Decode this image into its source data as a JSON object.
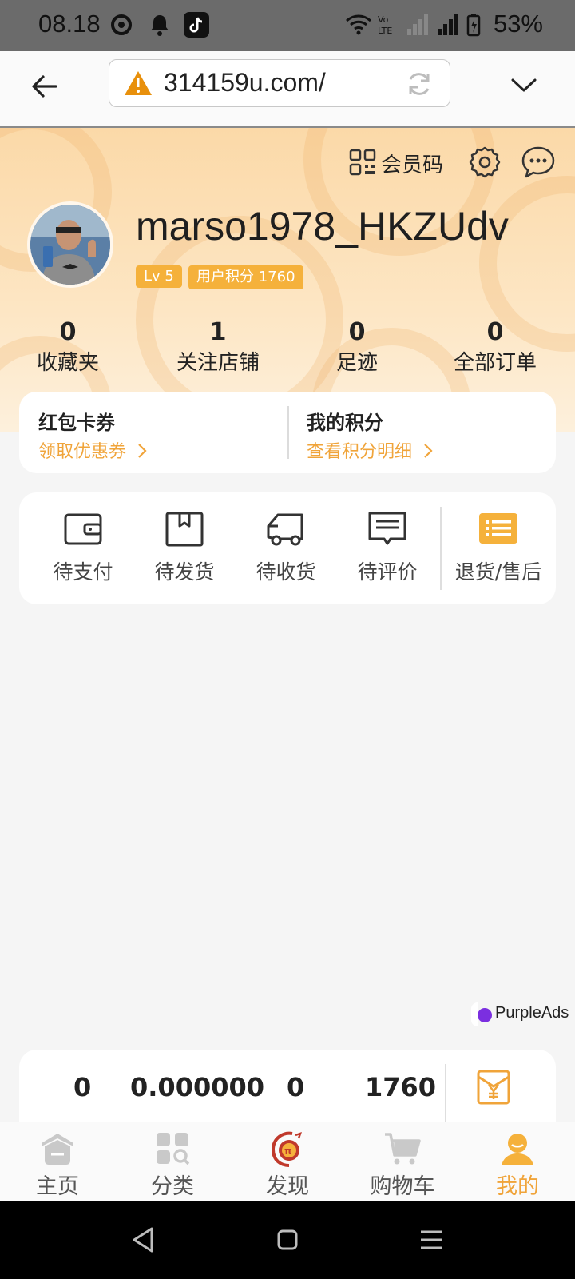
{
  "status_bar": {
    "time": "08.18",
    "battery": "53%",
    "icons": [
      "signal-ring-icon",
      "notification-bell-icon",
      "tiktok-icon",
      "wifi-icon",
      "volte-icon",
      "signal-icon",
      "battery-icon"
    ]
  },
  "browser": {
    "url": "314159u.com/",
    "icons": [
      "back-arrow-icon",
      "warning-icon",
      "reload-icon",
      "chevron-down-icon"
    ]
  },
  "profile": {
    "member_code_label": "会员码",
    "username": "marso1978_HKZUdv",
    "level": "Lv 5",
    "points_badge": "用户积分 1760"
  },
  "stats": [
    {
      "value": "0",
      "label": "收藏夹"
    },
    {
      "value": "1",
      "label": "关注店铺"
    },
    {
      "value": "0",
      "label": "足迹"
    },
    {
      "value": "0",
      "label": "全部订单"
    }
  ],
  "coupons": {
    "left_title": "红包卡券",
    "left_link": "领取优惠券",
    "right_title": "我的积分",
    "right_link": "查看积分明细",
    "accent": "#f0a43a"
  },
  "orders": [
    {
      "label": "待支付",
      "icon": "wallet-icon"
    },
    {
      "label": "待发货",
      "icon": "box-icon"
    },
    {
      "label": "待收货",
      "icon": "truck-icon"
    },
    {
      "label": "待评价",
      "icon": "comment-icon"
    },
    {
      "label": "退货/售后",
      "icon": "list-icon"
    }
  ],
  "ad": {
    "label": "PurpleAds"
  },
  "wallet": {
    "values": [
      "0",
      "0.000000",
      "0",
      "1760"
    ],
    "icon": "red-envelope-icon"
  },
  "tabs": [
    {
      "label": "主页",
      "icon": "home-icon",
      "active": false
    },
    {
      "label": "分类",
      "icon": "category-icon",
      "active": false
    },
    {
      "label": "发现",
      "icon": "discover-logo-icon",
      "active": false
    },
    {
      "label": "购物车",
      "icon": "cart-icon",
      "active": false
    },
    {
      "label": "我的",
      "icon": "user-icon",
      "active": true
    }
  ]
}
